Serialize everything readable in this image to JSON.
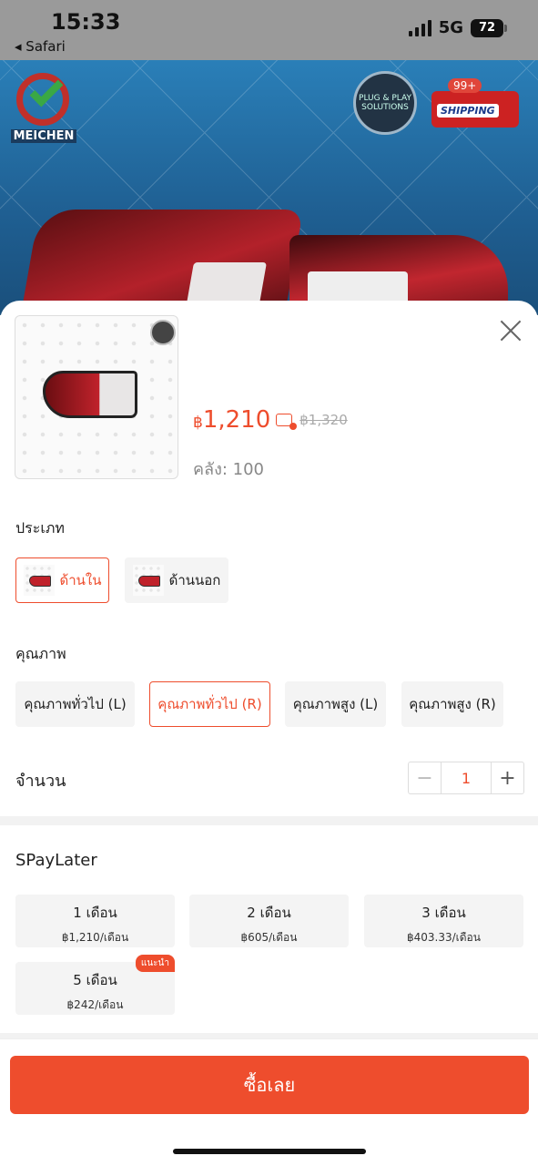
{
  "status_bar": {
    "time": "15:33",
    "back_app": "◂ Safari",
    "network": "5G",
    "battery": "72"
  },
  "hero": {
    "brand": "MEICHEN",
    "plug_badge": "PLUG & PLAY SOLUTIONS",
    "shipping_badge": "SHIPPING",
    "shipping_count": "99+"
  },
  "product": {
    "price_symbol": "฿",
    "price": "1,210",
    "original_price": "฿1,320",
    "stock": "คลัง: 100"
  },
  "variants": {
    "type_label": "ประเภท",
    "type_options": [
      {
        "label": "ด้านใน",
        "selected": true
      },
      {
        "label": "ด้านนอก",
        "selected": false
      }
    ],
    "quality_label": "คุณภาพ",
    "quality_options": [
      {
        "label": "คุณภาพทั่วไป (L)",
        "selected": false
      },
      {
        "label": "คุณภาพทั่วไป (R)",
        "selected": true
      },
      {
        "label": "คุณภาพสูง (L)",
        "selected": false
      },
      {
        "label": "คุณภาพสูง (R)",
        "selected": false
      }
    ]
  },
  "quantity": {
    "label": "จำนวน",
    "minus": "−",
    "value": "1",
    "plus": "+"
  },
  "spaylater": {
    "title": "SPayLater",
    "plans": [
      {
        "months": "1 เดือน",
        "price": "฿1,210/เดือน"
      },
      {
        "months": "2 เดือน",
        "price": "฿605/เดือน"
      },
      {
        "months": "3 เดือน",
        "price": "฿403.33/เดือน"
      },
      {
        "months": "5 เดือน",
        "price": "฿242/เดือน",
        "badge": "แนะนำ"
      }
    ]
  },
  "footer": {
    "buy_label": "ซื้อเลย"
  },
  "colors": {
    "accent": "#ee4d2d"
  }
}
